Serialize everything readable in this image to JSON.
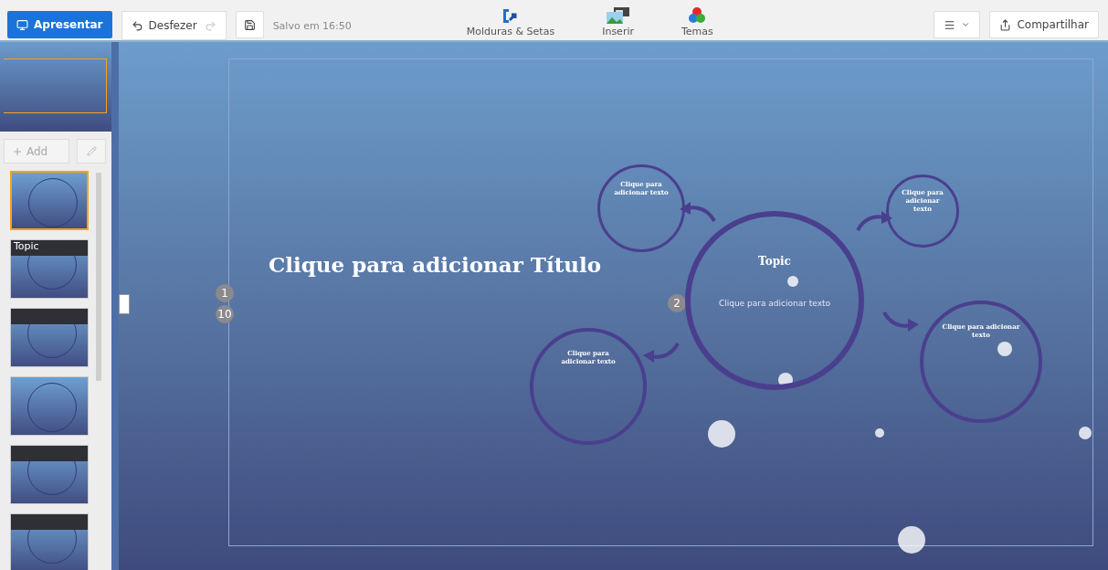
{
  "toolbar": {
    "present_button": {
      "label": "Apresentar"
    },
    "undo_button": {
      "label": "Desfezer"
    },
    "redo_button": {
      "disabled": true
    },
    "save_status": "Salvo em 16:50",
    "tools": [
      {
        "kind": "frames",
        "label": "Molduras & Setas"
      },
      {
        "kind": "insert",
        "label": "Inserir"
      },
      {
        "kind": "themes",
        "label": "Temas"
      }
    ],
    "share_button": {
      "label": "Compartilhar"
    }
  },
  "sidebar": {
    "add_button": {
      "label": "Add"
    },
    "thumbnails": [
      {
        "kind": "plain",
        "selected": true
      },
      {
        "kind": "banner",
        "title": "Topic",
        "selected": false
      },
      {
        "kind": "banner",
        "selected": false
      },
      {
        "kind": "plain",
        "selected": false
      },
      {
        "kind": "banner",
        "selected": false
      },
      {
        "kind": "banner",
        "selected": false
      }
    ]
  },
  "canvas": {
    "title": "Clique para adicionar Título",
    "path_numbers": [
      {
        "label": "1"
      },
      {
        "label": "10"
      },
      {
        "label": "2"
      }
    ],
    "circles": [
      {
        "kind": "main",
        "heading": "Topic",
        "body": "Clique para adicionar texto"
      },
      {
        "kind": "sub",
        "heading": "Clique para adicionar texto"
      },
      {
        "kind": "sub",
        "heading": "Clique para adicionar texto"
      },
      {
        "kind": "sub",
        "heading": "Clique para adicionar texto"
      },
      {
        "kind": "sub",
        "heading": "Clique para adicionar texto"
      }
    ]
  }
}
